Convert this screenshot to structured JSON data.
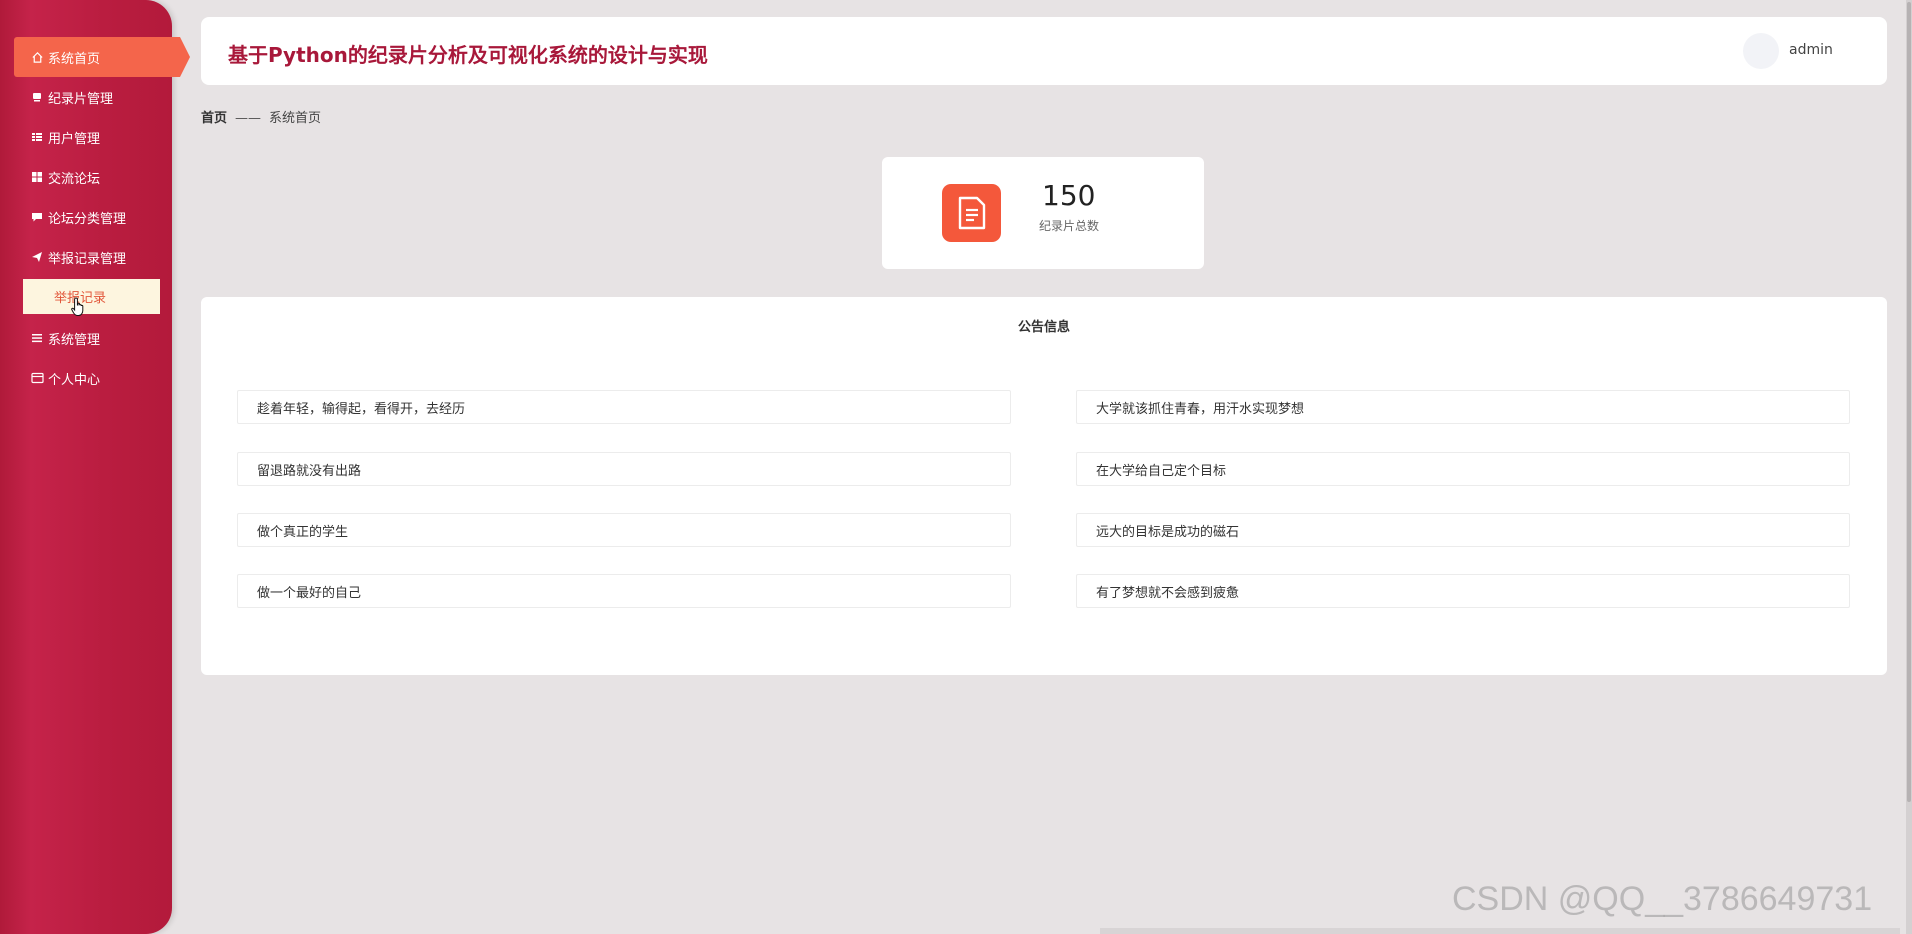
{
  "sidebar": {
    "items": [
      {
        "label": "系统首页",
        "icon": "home-icon",
        "active": true
      },
      {
        "label": "纪录片管理",
        "icon": "film-icon"
      },
      {
        "label": "用户管理",
        "icon": "grid-icon"
      },
      {
        "label": "交流论坛",
        "icon": "apps-icon"
      },
      {
        "label": "论坛分类管理",
        "icon": "chat-icon"
      },
      {
        "label": "举报记录管理",
        "icon": "send-icon"
      },
      {
        "label": "系统管理",
        "icon": "menu-icon"
      },
      {
        "label": "个人中心",
        "icon": "card-icon"
      }
    ],
    "subitem": {
      "label": "举报记录"
    }
  },
  "header": {
    "title": "基于Python的纪录片分析及可视化系统的设计与实现",
    "username": "admin"
  },
  "breadcrumb": {
    "home": "首页",
    "separator": "——",
    "current": "系统首页"
  },
  "stat": {
    "value": "150",
    "label": "纪录片总数",
    "icon": "document-icon"
  },
  "notices": {
    "title": "公告信息",
    "items": [
      "趁着年轻，输得起，看得开，去经历",
      "大学就该抓住青春，用汗水实现梦想",
      "留退路就没有出路",
      "在大学给自己定个目标",
      "做个真正的学生",
      "远大的目标是成功的磁石",
      "做一个最好的自己",
      "有了梦想就不会感到疲惫"
    ]
  },
  "watermark": "CSDN @QQ__3786649731",
  "colors": {
    "sidebar": "#b31a3b",
    "active": "#f4654b",
    "title": "#a8183a",
    "stat_icon": "#f4583b",
    "subitem_bg": "#fdf5df"
  }
}
